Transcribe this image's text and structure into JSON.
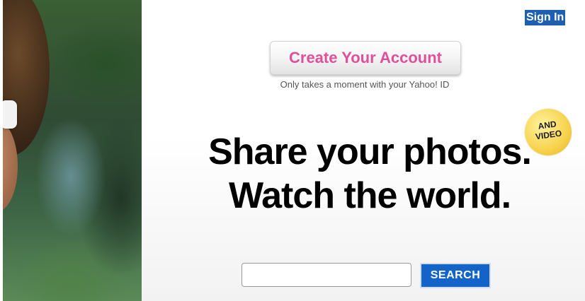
{
  "header": {
    "sign_in_label": "Sign In"
  },
  "signup": {
    "create_account_label": "Create Your Account",
    "subtext": "Only takes a moment with your Yahoo! ID"
  },
  "badge": {
    "line1": "AND",
    "line2": "VIDEO"
  },
  "hero": {
    "line1": "Share your photos.",
    "line2": "Watch the world."
  },
  "search": {
    "value": "",
    "placeholder": "",
    "button_label": "SEARCH"
  },
  "colors": {
    "accent_pink": "#e0509a",
    "search_blue": "#1463c8",
    "signin_bg": "#1e5fb3",
    "badge_yellow": "#f7d24b"
  }
}
